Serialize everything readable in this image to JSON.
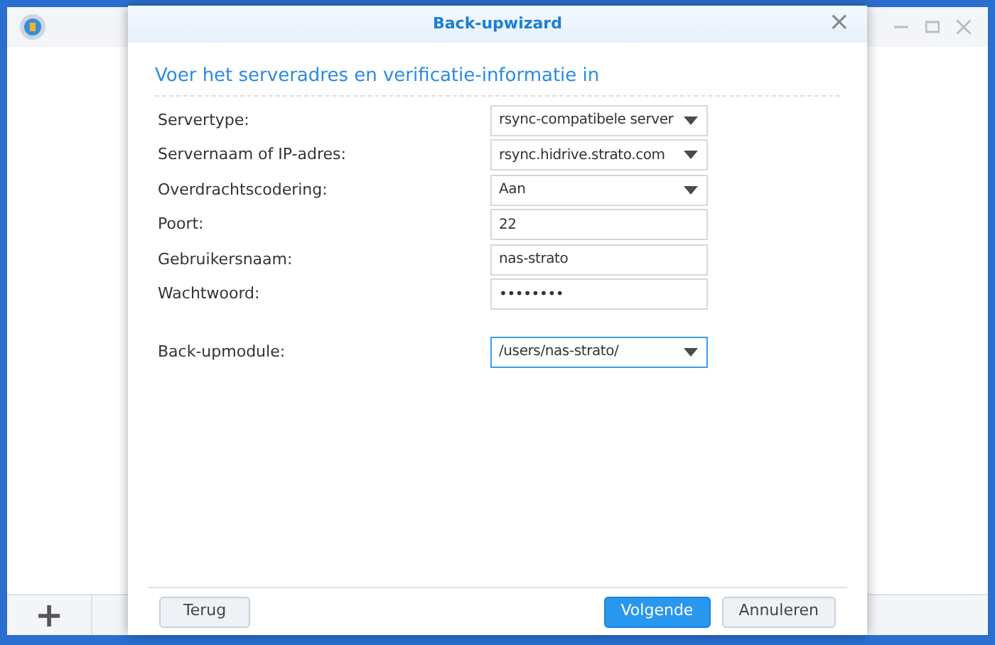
{
  "background_window": {
    "add_button": "+"
  },
  "dialog": {
    "title": "Back-upwizard",
    "close": "×",
    "heading": "Voer het serveradres en verificatie-informatie in",
    "fields": [
      {
        "label": "Servertype:",
        "kind": "select",
        "value": "rsync-compatibele server",
        "focused": false
      },
      {
        "label": "Servernaam of IP-adres:",
        "kind": "select",
        "value": "rsync.hidrive.strato.com",
        "focused": false
      },
      {
        "label": "Overdrachtscodering:",
        "kind": "select",
        "value": "Aan",
        "focused": false
      },
      {
        "label": "Poort:",
        "kind": "text",
        "value": "22",
        "focused": false
      },
      {
        "label": "Gebruikersnaam:",
        "kind": "text",
        "value": "nas-strato",
        "focused": false
      },
      {
        "label": "Wachtwoord:",
        "kind": "password",
        "value": "••••••••",
        "focused": false
      },
      {
        "label": "Back-upmodule:",
        "kind": "select",
        "value": "/users/nas-strato/",
        "focused": true
      }
    ],
    "buttons": [
      {
        "label": "Terug",
        "primary": false
      },
      {
        "label": "Volgende",
        "primary": true
      },
      {
        "label": "Annuleren",
        "primary": false
      }
    ]
  }
}
